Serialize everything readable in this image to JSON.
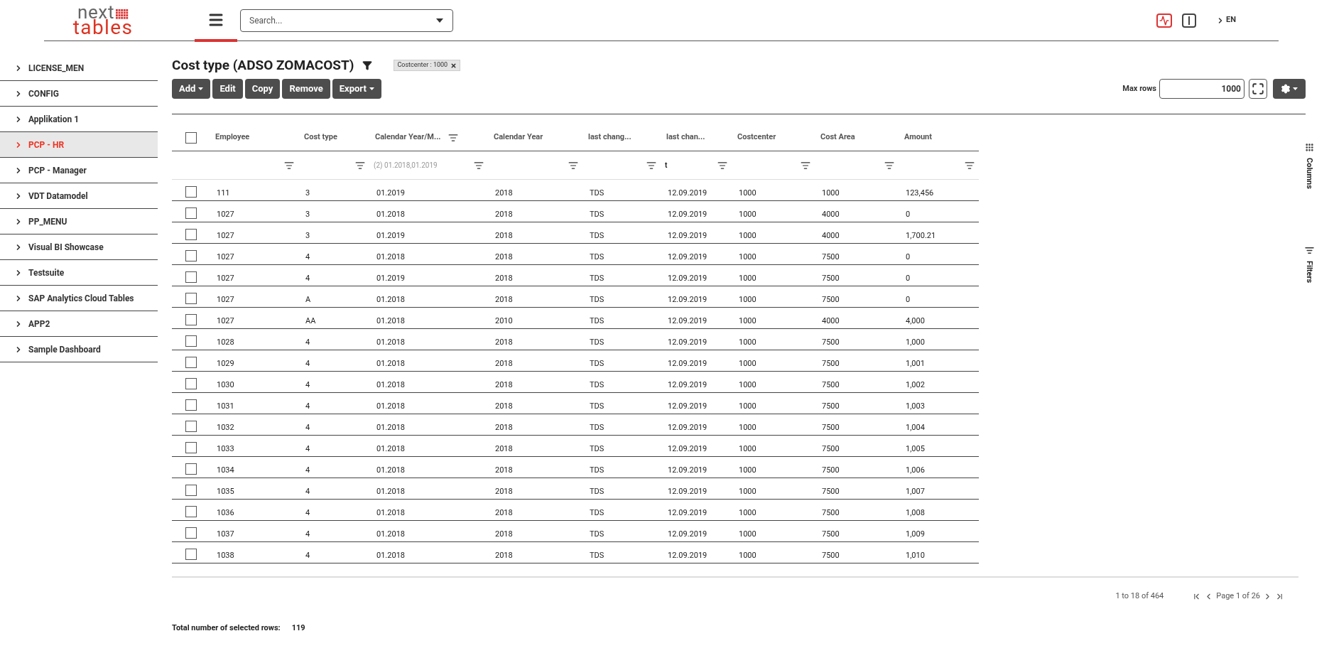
{
  "logo": {
    "line1": "next",
    "line2": "tables"
  },
  "search": {
    "placeholder": "Search..."
  },
  "language": "EN",
  "sidebar": {
    "items": [
      {
        "label": "LICENSE_MEN",
        "selected": false
      },
      {
        "label": "CONFIG",
        "selected": false
      },
      {
        "label": "Applikation 1",
        "selected": false
      },
      {
        "label": "PCP - HR",
        "selected": true
      },
      {
        "label": "PCP - Manager",
        "selected": false
      },
      {
        "label": "VDT Datamodel",
        "selected": false
      },
      {
        "label": "PP_MENU",
        "selected": false
      },
      {
        "label": "Visual BI Showcase",
        "selected": false
      },
      {
        "label": "Testsuite",
        "selected": false
      },
      {
        "label": "SAP Analytics Cloud Tables",
        "selected": false
      },
      {
        "label": "APP2",
        "selected": false
      },
      {
        "label": "Sample Dashboard",
        "selected": false
      }
    ]
  },
  "page": {
    "title": "Cost type (ADSO ZOMACOST)",
    "filter_chips": [
      {
        "label": "Costcenter : 1000"
      }
    ]
  },
  "toolbar": {
    "buttons": [
      {
        "label": "Add",
        "dropdown": true
      },
      {
        "label": "Edit",
        "dropdown": false
      },
      {
        "label": "Copy",
        "dropdown": false
      },
      {
        "label": "Remove",
        "dropdown": false
      },
      {
        "label": "Export",
        "dropdown": true
      }
    ],
    "max_rows": {
      "label": "Max rows",
      "value": "1000"
    }
  },
  "table": {
    "header_checked": false,
    "columns": [
      {
        "label": "Employee",
        "filtered": false
      },
      {
        "label": "Cost type",
        "filtered": false
      },
      {
        "label": "Calendar Year/M...",
        "filtered": true,
        "filter_value": "(2) 01.2018,01.2019"
      },
      {
        "label": "Calendar Year",
        "filtered": false
      },
      {
        "label": "last chang...",
        "filtered": false
      },
      {
        "label": "last chan...",
        "filtered": false,
        "filter_value": "t"
      },
      {
        "label": "Costcenter",
        "filtered": false
      },
      {
        "label": "Cost Area",
        "filtered": false
      },
      {
        "label": "Amount",
        "filtered": false
      }
    ],
    "rows": [
      {
        "checked": false,
        "cells": [
          "111",
          "3",
          "01.2019",
          "2018",
          "TDS",
          "12.09.2019",
          "1000",
          "1000",
          "123,456"
        ]
      },
      {
        "checked": false,
        "cells": [
          "1027",
          "3",
          "01.2018",
          "2018",
          "TDS",
          "12.09.2019",
          "1000",
          "4000",
          "0"
        ]
      },
      {
        "checked": false,
        "cells": [
          "1027",
          "3",
          "01.2019",
          "2018",
          "TDS",
          "12.09.2019",
          "1000",
          "4000",
          "1,700.21"
        ]
      },
      {
        "checked": false,
        "cells": [
          "1027",
          "4",
          "01.2018",
          "2018",
          "TDS",
          "12.09.2019",
          "1000",
          "7500",
          "0"
        ]
      },
      {
        "checked": false,
        "cells": [
          "1027",
          "4",
          "01.2019",
          "2018",
          "TDS",
          "12.09.2019",
          "1000",
          "7500",
          "0"
        ]
      },
      {
        "checked": false,
        "cells": [
          "1027",
          "A",
          "01.2018",
          "2018",
          "TDS",
          "12.09.2019",
          "1000",
          "7500",
          "0"
        ]
      },
      {
        "checked": false,
        "cells": [
          "1027",
          "AA",
          "01.2018",
          "2010",
          "TDS",
          "12.09.2019",
          "1000",
          "4000",
          "4,000"
        ]
      },
      {
        "checked": false,
        "cells": [
          "1028",
          "4",
          "01.2018",
          "2018",
          "TDS",
          "12.09.2019",
          "1000",
          "7500",
          "1,000"
        ]
      },
      {
        "checked": false,
        "cells": [
          "1029",
          "4",
          "01.2018",
          "2018",
          "TDS",
          "12.09.2019",
          "1000",
          "7500",
          "1,001"
        ]
      },
      {
        "checked": false,
        "cells": [
          "1030",
          "4",
          "01.2018",
          "2018",
          "TDS",
          "12.09.2019",
          "1000",
          "7500",
          "1,002"
        ]
      },
      {
        "checked": false,
        "cells": [
          "1031",
          "4",
          "01.2018",
          "2018",
          "TDS",
          "12.09.2019",
          "1000",
          "7500",
          "1,003"
        ]
      },
      {
        "checked": false,
        "cells": [
          "1032",
          "4",
          "01.2018",
          "2018",
          "TDS",
          "12.09.2019",
          "1000",
          "7500",
          "1,004"
        ]
      },
      {
        "checked": false,
        "cells": [
          "1033",
          "4",
          "01.2018",
          "2018",
          "TDS",
          "12.09.2019",
          "1000",
          "7500",
          "1,005"
        ]
      },
      {
        "checked": false,
        "cells": [
          "1034",
          "4",
          "01.2018",
          "2018",
          "TDS",
          "12.09.2019",
          "1000",
          "7500",
          "1,006"
        ]
      },
      {
        "checked": false,
        "cells": [
          "1035",
          "4",
          "01.2018",
          "2018",
          "TDS",
          "12.09.2019",
          "1000",
          "7500",
          "1,007"
        ]
      },
      {
        "checked": false,
        "cells": [
          "1036",
          "4",
          "01.2018",
          "2018",
          "TDS",
          "12.09.2019",
          "1000",
          "7500",
          "1,008"
        ]
      },
      {
        "checked": false,
        "cells": [
          "1037",
          "4",
          "01.2018",
          "2018",
          "TDS",
          "12.09.2019",
          "1000",
          "7500",
          "1,009"
        ]
      },
      {
        "checked": false,
        "cells": [
          "1038",
          "4",
          "01.2018",
          "2018",
          "TDS",
          "12.09.2019",
          "1000",
          "7500",
          "1,010"
        ]
      }
    ]
  },
  "side_panel": {
    "tabs": [
      {
        "label": "Columns",
        "kind": "columns"
      },
      {
        "label": "Filters",
        "kind": "filters"
      }
    ]
  },
  "pagination": {
    "range": "1 to 18 of 464",
    "page": "Page 1 of 26"
  },
  "footer": {
    "label": "Total number of selected rows:",
    "value": "119"
  }
}
